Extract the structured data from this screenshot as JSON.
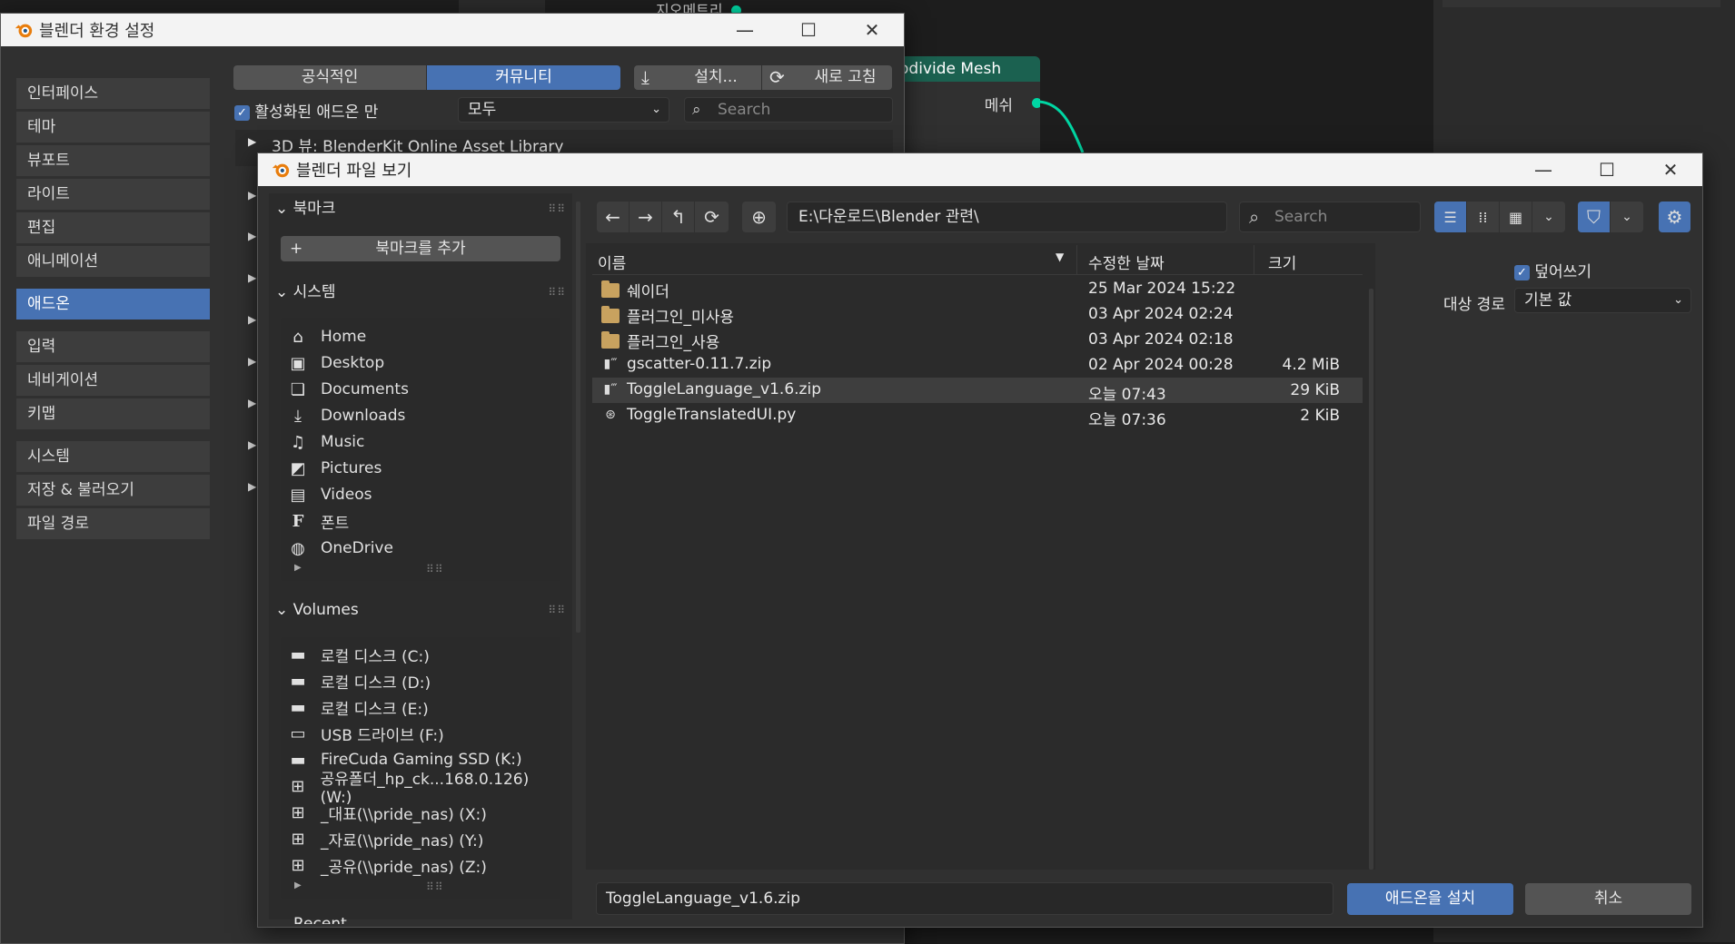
{
  "background": {
    "node_title": "odivide Mesh",
    "node_output": "메쉬",
    "partial_top_label": "지오메트리"
  },
  "prefs": {
    "title": "블렌더 환경 설정",
    "sidebar": [
      "인터페이스",
      "테마",
      "뷰포트",
      "라이트",
      "편집",
      "애니메이션",
      "애드온",
      "입력",
      "네비게이션",
      "키맵",
      "시스템",
      "저장 & 불러오기",
      "파일 경로"
    ],
    "tabs": {
      "official": "공식적인",
      "community": "커뮤니티"
    },
    "install_label": "설치...",
    "refresh_label": "새로 고침",
    "enabled_only_label": "활성화된 애드온 만",
    "category_value": "모두",
    "search_placeholder": "Search",
    "first_addon": "3D 뷰: BlenderKit Online Asset Library"
  },
  "browser": {
    "title": "블렌더 파일 보기",
    "bookmarks_header": "북마크",
    "add_bookmark": "북마크를 추가",
    "system_header": "시스템",
    "system_items": [
      {
        "label": "Home",
        "icon": "home-icon"
      },
      {
        "label": "Desktop",
        "icon": "desktop-icon"
      },
      {
        "label": "Documents",
        "icon": "documents-icon"
      },
      {
        "label": "Downloads",
        "icon": "download-icon"
      },
      {
        "label": "Music",
        "icon": "music-icon"
      },
      {
        "label": "Pictures",
        "icon": "pictures-icon"
      },
      {
        "label": "Videos",
        "icon": "videos-icon"
      },
      {
        "label": "폰트",
        "icon": "font-icon"
      },
      {
        "label": "OneDrive",
        "icon": "globe-icon"
      }
    ],
    "volumes_header": "Volumes",
    "volume_items": [
      {
        "label": "로컬 디스크 (C:)",
        "icon": "disk-icon"
      },
      {
        "label": "로컬 디스크 (D:)",
        "icon": "disk-icon"
      },
      {
        "label": "로컬 디스크 (E:)",
        "icon": "disk-icon"
      },
      {
        "label": "USB 드라이브 (F:)",
        "icon": "usb-icon"
      },
      {
        "label": "FireCuda Gaming SSD (K:)",
        "icon": "disk-icon"
      },
      {
        "label": "공유폴더_hp_ck...168.0.126) (W:)",
        "icon": "network-icon"
      },
      {
        "label": "_대표(\\\\pride_nas) (X:)",
        "icon": "network-icon"
      },
      {
        "label": "_자료(\\\\pride_nas) (Y:)",
        "icon": "network-icon"
      },
      {
        "label": "_공유(\\\\pride_nas) (Z:)",
        "icon": "network-icon"
      }
    ],
    "recent_header": "Recent",
    "path": "E:\\다운로드\\Blender 관련\\",
    "search_placeholder": "Search",
    "columns": {
      "name": "이름",
      "date": "수정한 날짜",
      "size": "크기"
    },
    "files": [
      {
        "name": "쉐이더",
        "date": "25 Mar 2024 15:22",
        "size": "",
        "type": "folder"
      },
      {
        "name": "플러그인_미사용",
        "date": "03 Apr 2024 02:24",
        "size": "",
        "type": "folder"
      },
      {
        "name": "플러그인_사용",
        "date": "03 Apr 2024 02:18",
        "size": "",
        "type": "folder"
      },
      {
        "name": "gscatter-0.11.7.zip",
        "date": "02 Apr 2024 00:28",
        "size": "4.2 MiB",
        "type": "zip"
      },
      {
        "name": "ToggleLanguage_v1.6.zip",
        "date": "오늘 07:43",
        "size": "29 KiB",
        "type": "zip",
        "selected": true
      },
      {
        "name": "ToggleTranslatedUI.py",
        "date": "오늘 07:36",
        "size": "2 KiB",
        "type": "python"
      }
    ],
    "overwrite_label": "덮어쓰기",
    "target_path_label": "대상 경로",
    "target_path_value": "기본 값",
    "filename": "ToggleLanguage_v1.6.zip",
    "install_button": "애드온을 설치",
    "cancel_button": "취소"
  },
  "colors": {
    "accent": "#4772b3",
    "node_header": "#1b6150",
    "socket": "#00d6a3",
    "folder": "#c8a25f"
  }
}
